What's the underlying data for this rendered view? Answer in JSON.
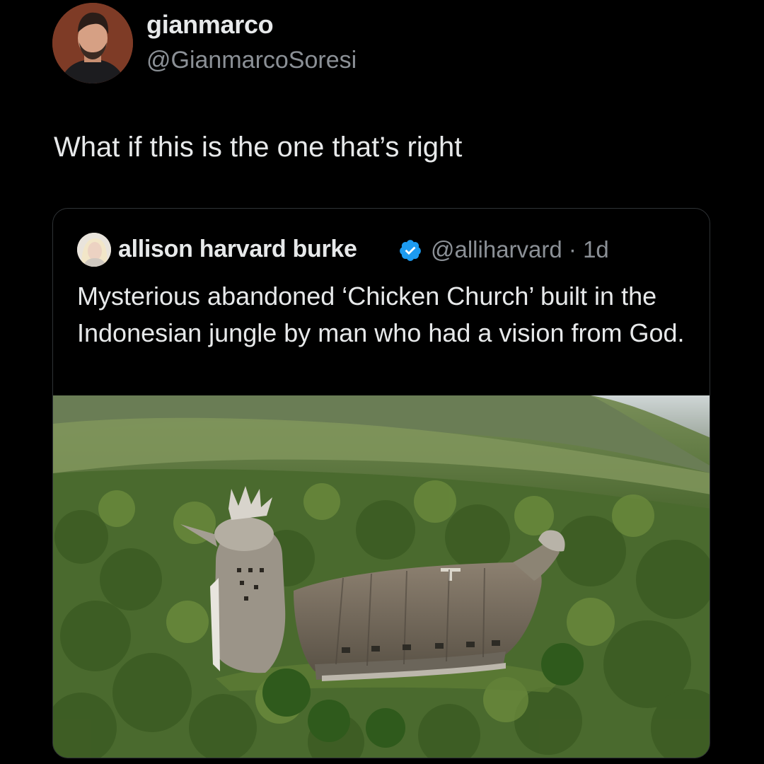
{
  "author": {
    "display_name": "gianmarco",
    "handle": "@GianmarcoSoresi"
  },
  "tweet_text": "What if this is the one that’s right",
  "quoted": {
    "display_name": "allison harvard burke",
    "handle_time": "@alliharvard · 1d",
    "verified_icon": "verified-badge-icon",
    "text": "Mysterious abandoned ‘Chicken Church’ built in the Indonesian jungle by man who had a vision from God."
  },
  "colors": {
    "background": "#000000",
    "primary_text": "#e7e9ea",
    "secondary_text": "#8b9096",
    "verified_blue": "#1d9bf0",
    "border": "#2f3336"
  }
}
